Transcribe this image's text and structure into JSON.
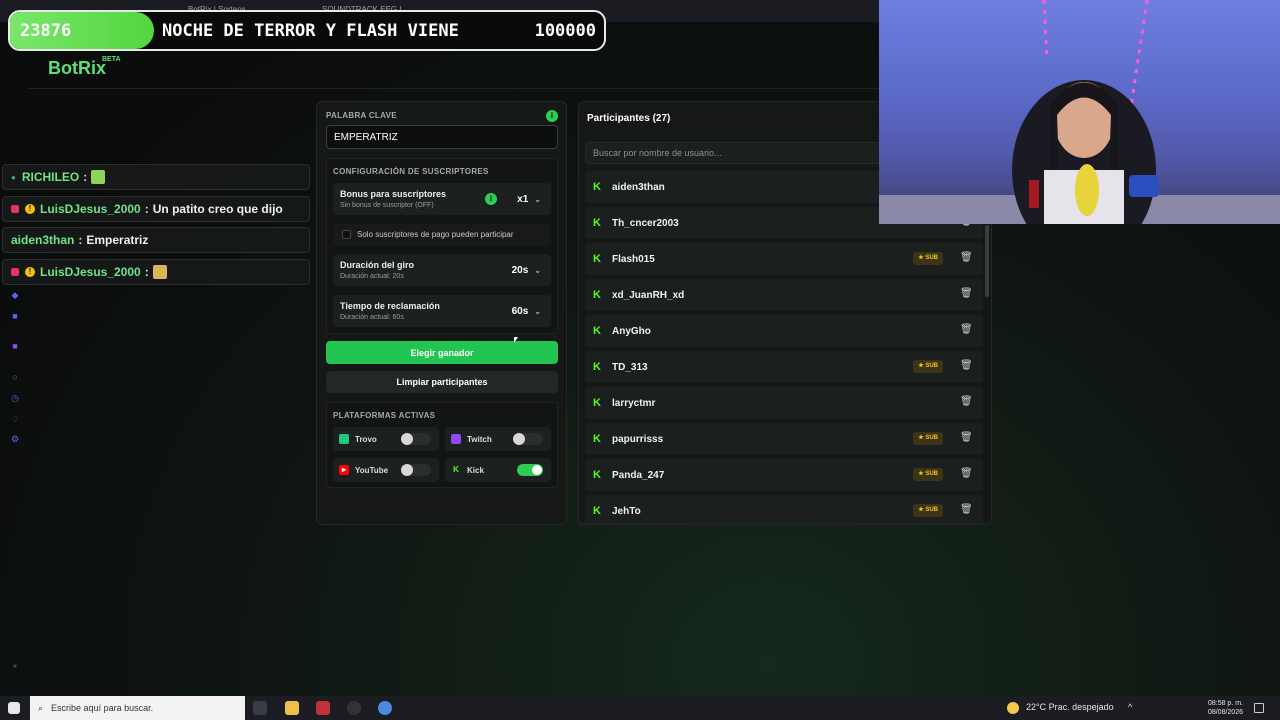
{
  "browser_tabs": [
    "BotRix | Sorteos",
    "SOUNDTRACK EEG |"
  ],
  "banner": {
    "count": "23876",
    "title": "NOCHE DE TERROR Y FLASH VIENE",
    "goal": "100000"
  },
  "logo": {
    "name": "BotRix",
    "badge": "BETA"
  },
  "chat": [
    {
      "user": "RICHILEO",
      "message": "",
      "emote": true
    },
    {
      "user": "LuisDJesus_2000",
      "message": "Un patito creo que dijo",
      "emote": false
    },
    {
      "user": "aiden3than",
      "message": "Emperatriz",
      "emote": false
    },
    {
      "user": "LuisDJesus_2000",
      "message": "",
      "emote": true
    }
  ],
  "keyword": {
    "label": "PALABRA CLAVE",
    "value": "EMPERATRIZ"
  },
  "subs_config": {
    "label": "CONFIGURACIÓN DE SUSCRIPTORES",
    "bonus": {
      "title": "Bonus para suscriptores",
      "desc": "Sin bonus de suscriptor (OFF)",
      "value": "x1"
    },
    "only_subs": "Solo suscriptores de pago pueden participar",
    "duration": {
      "title": "Duración del giro",
      "desc": "Duración actual: 20s",
      "value": "20s"
    },
    "claim": {
      "title": "Tiempo de reclamación",
      "desc": "Duración actual: 60s",
      "value": "60s"
    }
  },
  "buttons": {
    "pick_winner": "Elegir ganador",
    "clear": "Limpiar participantes"
  },
  "platforms": {
    "label": "PLATAFORMAS ACTIVAS",
    "items": [
      {
        "name": "Trovo",
        "on": false,
        "color": "#1fc881"
      },
      {
        "name": "Twitch",
        "on": false,
        "color": "#9146ff"
      },
      {
        "name": "YouTube",
        "on": false,
        "color": "#ff0000"
      },
      {
        "name": "Kick",
        "on": true,
        "color": "#53fc18"
      }
    ]
  },
  "participants": {
    "title": "Participantes (27)",
    "search_placeholder": "Buscar por nombre de usuario...",
    "sub_label": "SUB",
    "list": [
      {
        "name": "aiden3than",
        "sub": false
      },
      {
        "name": "Th_cncer2003",
        "sub": false
      },
      {
        "name": "Flash015",
        "sub": true
      },
      {
        "name": "xd_JuanRH_xd",
        "sub": false
      },
      {
        "name": "AnyGho",
        "sub": false
      },
      {
        "name": "TD_313",
        "sub": true
      },
      {
        "name": "larryctmr",
        "sub": false
      },
      {
        "name": "papurrisss",
        "sub": true
      },
      {
        "name": "Panda_247",
        "sub": true
      },
      {
        "name": "JehTo",
        "sub": true
      }
    ]
  },
  "taskbar": {
    "search_placeholder": "Escribe aquí para buscar.",
    "weather": "22°C  Prac. despejado",
    "time": "08:58 p. m.",
    "date": "08/08/2026"
  }
}
